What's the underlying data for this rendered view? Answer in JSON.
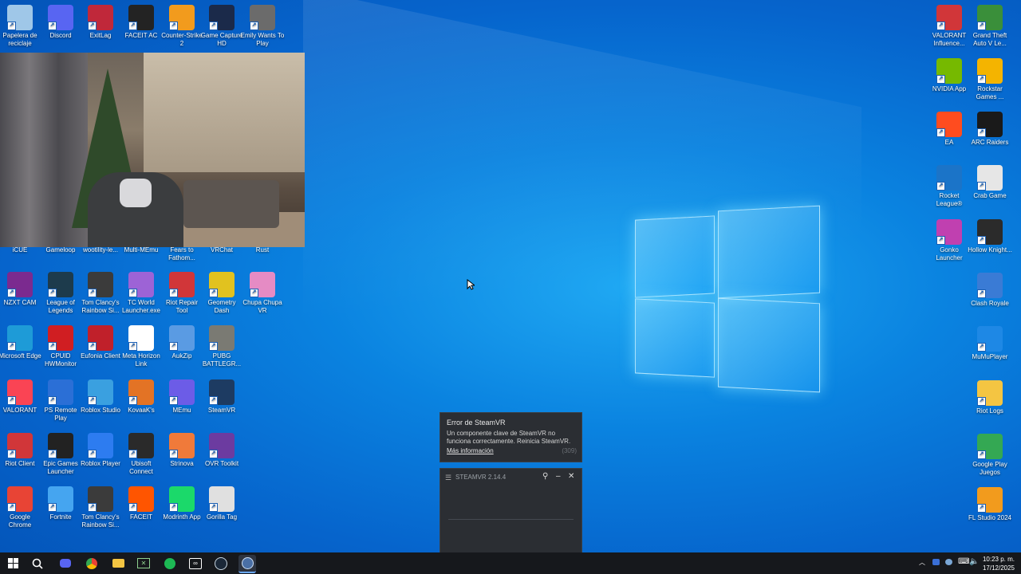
{
  "desktop": {
    "icons_left": [
      {
        "label": "Papelera de reciclaje",
        "icon": "recycle-bin-icon",
        "color": "#9fc7e8"
      },
      {
        "label": "Discord",
        "icon": "discord-icon",
        "color": "#5865f2"
      },
      {
        "label": "ExitLag",
        "icon": "exitlag-icon",
        "color": "#c0283a"
      },
      {
        "label": "FACEIT AC",
        "icon": "faceit-ac-icon",
        "color": "#232323"
      },
      {
        "label": "Counter-Strike 2",
        "icon": "counter-strike-icon",
        "color": "#f29b1d"
      },
      {
        "label": "Game Capture HD",
        "icon": "game-capture-icon",
        "color": "#1b2a4a"
      },
      {
        "label": "Emily Wants To Play",
        "icon": "emily-wants-to-play-icon",
        "color": "#6b6b6b"
      }
    ],
    "row_hidden_labels": [
      "iCUE",
      "Gameloop",
      "wootility-le...",
      "Multi-MEmu",
      "Fears to Fathom...",
      "VRChat",
      "Rust"
    ],
    "grid": [
      [
        {
          "label": "NZXT CAM",
          "icon": "nzxt-cam-icon",
          "color": "#7b2a8f"
        },
        {
          "label": "League of Legends",
          "icon": "league-of-legends-icon",
          "color": "#1d3b4c"
        },
        {
          "label": "Tom Clancy's Rainbow Si...",
          "icon": "rainbow-six-icon",
          "color": "#3b3b3b"
        },
        {
          "label": "TC World Launcher.exe",
          "icon": "tc-world-launcher-icon",
          "color": "#9d63d6"
        },
        {
          "label": "Riot Repair Tool",
          "icon": "riot-repair-icon",
          "color": "#d13639"
        },
        {
          "label": "Geometry Dash",
          "icon": "geometry-dash-icon",
          "color": "#e1c21f"
        },
        {
          "label": "Chupa Chupa VR",
          "icon": "chupa-chupa-vr-icon",
          "color": "#e58bc4"
        }
      ],
      [
        {
          "label": "Microsoft Edge",
          "icon": "edge-icon",
          "color": "#1e9bd7"
        },
        {
          "label": "CPUID HWMonitor",
          "icon": "hwmonitor-icon",
          "color": "#d01e22"
        },
        {
          "label": "Eufonia Client",
          "icon": "eufonia-icon",
          "color": "#c0202a"
        },
        {
          "label": "Meta Horizon Link",
          "icon": "meta-horizon-icon",
          "color": "#ffffff"
        },
        {
          "label": "AukZip",
          "icon": "aukzip-icon",
          "color": "#5a9be3"
        },
        {
          "label": "PUBG BATTLEGR...",
          "icon": "pubg-icon",
          "color": "#7a7a73"
        }
      ],
      [
        {
          "label": "VALORANT",
          "icon": "valorant-icon",
          "color": "#fa4454"
        },
        {
          "label": "PS Remote Play",
          "icon": "ps-remote-play-icon",
          "color": "#2b6fd6"
        },
        {
          "label": "Roblox Studio",
          "icon": "roblox-studio-icon",
          "color": "#3aa0e0"
        },
        {
          "label": "KovaaK's",
          "icon": "kovaaks-icon",
          "color": "#e37325"
        },
        {
          "label": "MEmu",
          "icon": "memu-icon",
          "color": "#6c5ce7"
        },
        {
          "label": "SteamVR",
          "icon": "steamvr-icon",
          "color": "#1d3b62"
        }
      ],
      [
        {
          "label": "Riot Client",
          "icon": "riot-client-icon",
          "color": "#d13639"
        },
        {
          "label": "Epic Games Launcher",
          "icon": "epic-games-icon",
          "color": "#222222"
        },
        {
          "label": "Roblox Player",
          "icon": "roblox-player-icon",
          "color": "#2d7cf0"
        },
        {
          "label": "Ubisoft Connect",
          "icon": "ubisoft-connect-icon",
          "color": "#2a2a2a"
        },
        {
          "label": "Strinova",
          "icon": "strinova-icon",
          "color": "#f07a3a"
        },
        {
          "label": "OVR Toolkit",
          "icon": "ovr-toolkit-icon",
          "color": "#6c3ba0"
        }
      ],
      [
        {
          "label": "Google Chrome",
          "icon": "chrome-icon",
          "color": "#e84435"
        },
        {
          "label": "Fortnite",
          "icon": "fortnite-icon",
          "color": "#45a5f0"
        },
        {
          "label": "Tom Clancy's Rainbow Si...",
          "icon": "rainbow-six-icon",
          "color": "#3b3b3b"
        },
        {
          "label": "FACEIT",
          "icon": "faceit-icon",
          "color": "#ff5500"
        },
        {
          "label": "Modrinth App",
          "icon": "modrinth-icon",
          "color": "#1bd96a"
        },
        {
          "label": "Gorilla Tag",
          "icon": "gorilla-tag-icon",
          "color": "#e0e0e0"
        }
      ]
    ],
    "icons_right_col1": [
      {
        "label": "VALORANT Influence...",
        "icon": "valorant-influence-icon",
        "color": "#d13639"
      },
      {
        "label": "NVIDIA App",
        "icon": "nvidia-app-icon",
        "color": "#76b900"
      },
      {
        "label": "EA",
        "icon": "ea-icon",
        "color": "#ff4c1f"
      },
      {
        "label": "Rocket League®",
        "icon": "rocket-league-icon",
        "color": "#1b74c8"
      },
      {
        "label": "Gonko Launcher",
        "icon": "gonko-launcher-icon",
        "color": "#c040b0"
      }
    ],
    "icons_right_col2": [
      {
        "label": "Grand Theft Auto V Le...",
        "icon": "gta-v-icon",
        "color": "#3a8f3a"
      },
      {
        "label": "Rockstar Games ...",
        "icon": "rockstar-icon",
        "color": "#f4b400"
      },
      {
        "label": "ARC Raiders",
        "icon": "arc-raiders-icon",
        "color": "#1a1a1a"
      },
      {
        "label": "Crab Game",
        "icon": "crab-game-icon",
        "color": "#e6e6e6"
      },
      {
        "label": "Hollow Knight...",
        "icon": "hollow-knight-icon",
        "color": "#2b2b2b"
      },
      {
        "label": "Clash Royale",
        "icon": "clash-royale-icon",
        "color": "#3a7bd5"
      },
      {
        "label": "MuMuPlayer",
        "icon": "mumuplayer-icon",
        "color": "#1e88e5"
      },
      {
        "label": "Riot Logs",
        "icon": "folder-icon",
        "color": "#f4c542"
      },
      {
        "label": "Google Play Juegos",
        "icon": "google-play-games-icon",
        "color": "#34a853"
      },
      {
        "label": "FL Studio 2024",
        "icon": "fl-studio-icon",
        "color": "#f29b1d"
      }
    ]
  },
  "notification": {
    "title": "Error de SteamVR",
    "message": "Un componente clave de SteamVR no funciona correctamente. Reinicia SteamVR.",
    "link": "Más información",
    "code": "(309)"
  },
  "steamvr_window": {
    "title": "STEAMVR 2.14.4"
  },
  "taskbar": {
    "items": [
      "start-icon",
      "search-icon",
      "discord-icon",
      "chrome-icon",
      "file-explorer-icon",
      "xbox-icon",
      "spotify-icon",
      "meta-icon",
      "steam-icon",
      "steamvr-icon"
    ],
    "clock_time": "10:23 p. m.",
    "clock_date": "17/12/2025"
  }
}
